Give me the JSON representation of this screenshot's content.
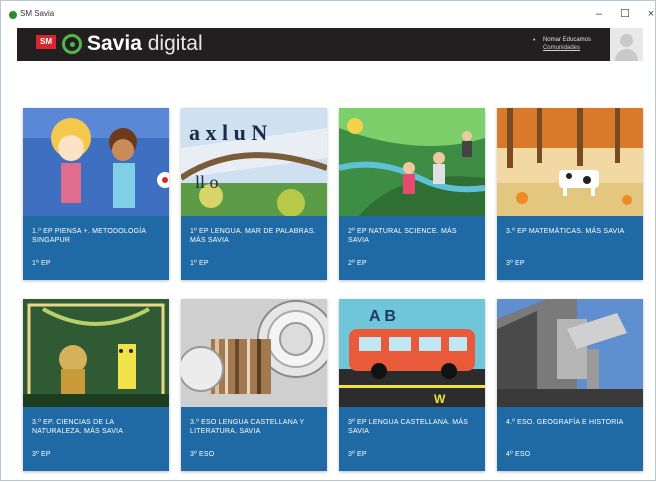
{
  "window": {
    "title": "SM Savia",
    "minimize": "–",
    "maximize": "☐",
    "close": "×"
  },
  "header": {
    "sm_logo": "SM",
    "brand_bold": "Savia",
    "brand_light": "digital",
    "user_name": "Nomar Educamos",
    "user_link": "Comunidades"
  },
  "courses": [
    {
      "title": "1.º EP PIENSA +. METODOLOGÍA SINGAPUR",
      "level": "1º EP"
    },
    {
      "title": "1º EP LENGUA. MAR DE PALABRAS. MÁS SAVIA",
      "level": "1º EP"
    },
    {
      "title": "2º EP NATURAL SCIENCE. MÁS SAVIA",
      "level": "2º EP"
    },
    {
      "title": "3.º EP MATEMÁTICAS. MÁS SAVIA",
      "level": "3º EP"
    },
    {
      "title": "3.º EP. CIENCIAS DE LA NATURALEZA. MÁS SAVIA",
      "level": "3º EP"
    },
    {
      "title": "3.º ESO LENGUA CASTELLANA Y LITERATURA. SAVIA",
      "level": "3º ESO"
    },
    {
      "title": "3º EP LENGUA CASTELLANA. MÁS SAVIA",
      "level": "3º EP"
    },
    {
      "title": "4.º ESO. GEOGRAFÍA E HISTORIA",
      "level": "4º ESO"
    }
  ]
}
